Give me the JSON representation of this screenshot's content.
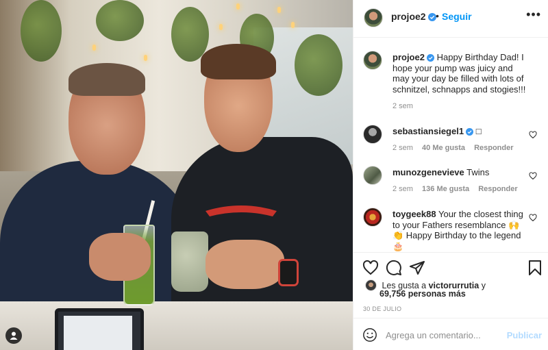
{
  "colors": {
    "accent": "#0095f6",
    "text": "#262626",
    "muted": "#8e8e8e",
    "divider": "#efefef",
    "publish_disabled": "#b3dbff"
  },
  "header": {
    "username": "projoe2",
    "separator": "•",
    "follow_label": "Seguir",
    "more_icon": "ellipsis-icon"
  },
  "caption": {
    "username": "projoe2",
    "text": "Happy Birthday Dad! I hope your pump was juicy and may your day be filled with lots of schnitzel, schnapps and stogies!!!",
    "time": "2 sem"
  },
  "comments": [
    {
      "username": "sebastiansiegel1",
      "text": "",
      "trailing_icon": "□",
      "time": "2 sem",
      "likes": "40 Me gusta",
      "reply": "Responder"
    },
    {
      "username": "munozgenevieve",
      "text": "Twins",
      "time": "2 sem",
      "likes": "136 Me gusta",
      "reply": "Responder"
    },
    {
      "username": "toygeek88",
      "text": "Your the closest thing to your Fathers resemblance 🙌 👏 Happy Birthday to the legend 🎂"
    }
  ],
  "actions": {
    "icons": [
      "heart-icon",
      "comment-icon",
      "share-icon",
      "bookmark-icon"
    ]
  },
  "likes": {
    "prefix": "Les gusta a",
    "user": "victorurrutia",
    "connector": "y",
    "others": "69,756 personas más"
  },
  "date": "30 DE JULIO",
  "composer": {
    "placeholder": "Agrega un comentario...",
    "publish_label": "Publicar"
  }
}
